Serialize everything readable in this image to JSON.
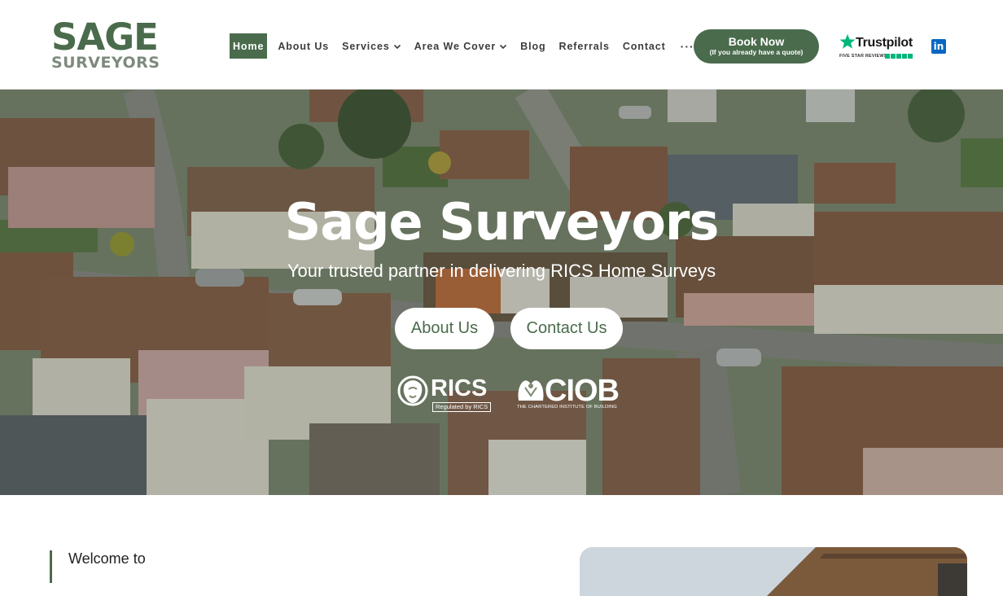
{
  "logo": {
    "top": "SAGE",
    "bottom": "SURVEYORS"
  },
  "nav": {
    "items": [
      {
        "label": "Home",
        "active": true
      },
      {
        "label": "About Us"
      },
      {
        "label": "Services",
        "dropdown": true
      },
      {
        "label": "Area We Cover",
        "dropdown": true
      },
      {
        "label": "Blog"
      },
      {
        "label": "Referrals"
      },
      {
        "label": "Contact"
      }
    ],
    "more": "···"
  },
  "book": {
    "label": "Book Now",
    "sublabel": "(If you already have a quote)"
  },
  "trustpilot": {
    "name": "Trustpilot",
    "sub": "FIVE STAR REVIEWS"
  },
  "linkedin": {
    "label": "in"
  },
  "hero": {
    "title": "Sage Surveyors",
    "subtitle": "Your trusted partner in delivering RICS Home Surveys",
    "about_button": "About Us",
    "contact_button": "Contact Us"
  },
  "accreditations": {
    "rics": {
      "name": "RICS",
      "tag": "Regulated by RICS"
    },
    "ciob": {
      "name": "CIOB",
      "tag": "THE CHARTERED INSTITUTE OF BUILDING"
    }
  },
  "welcome": {
    "label": "Welcome to"
  },
  "colors": {
    "brand": "#4a6b4c",
    "brand_light": "#7d8a7e",
    "trustpilot": "#00b67a",
    "linkedin": "#0a66c2"
  }
}
